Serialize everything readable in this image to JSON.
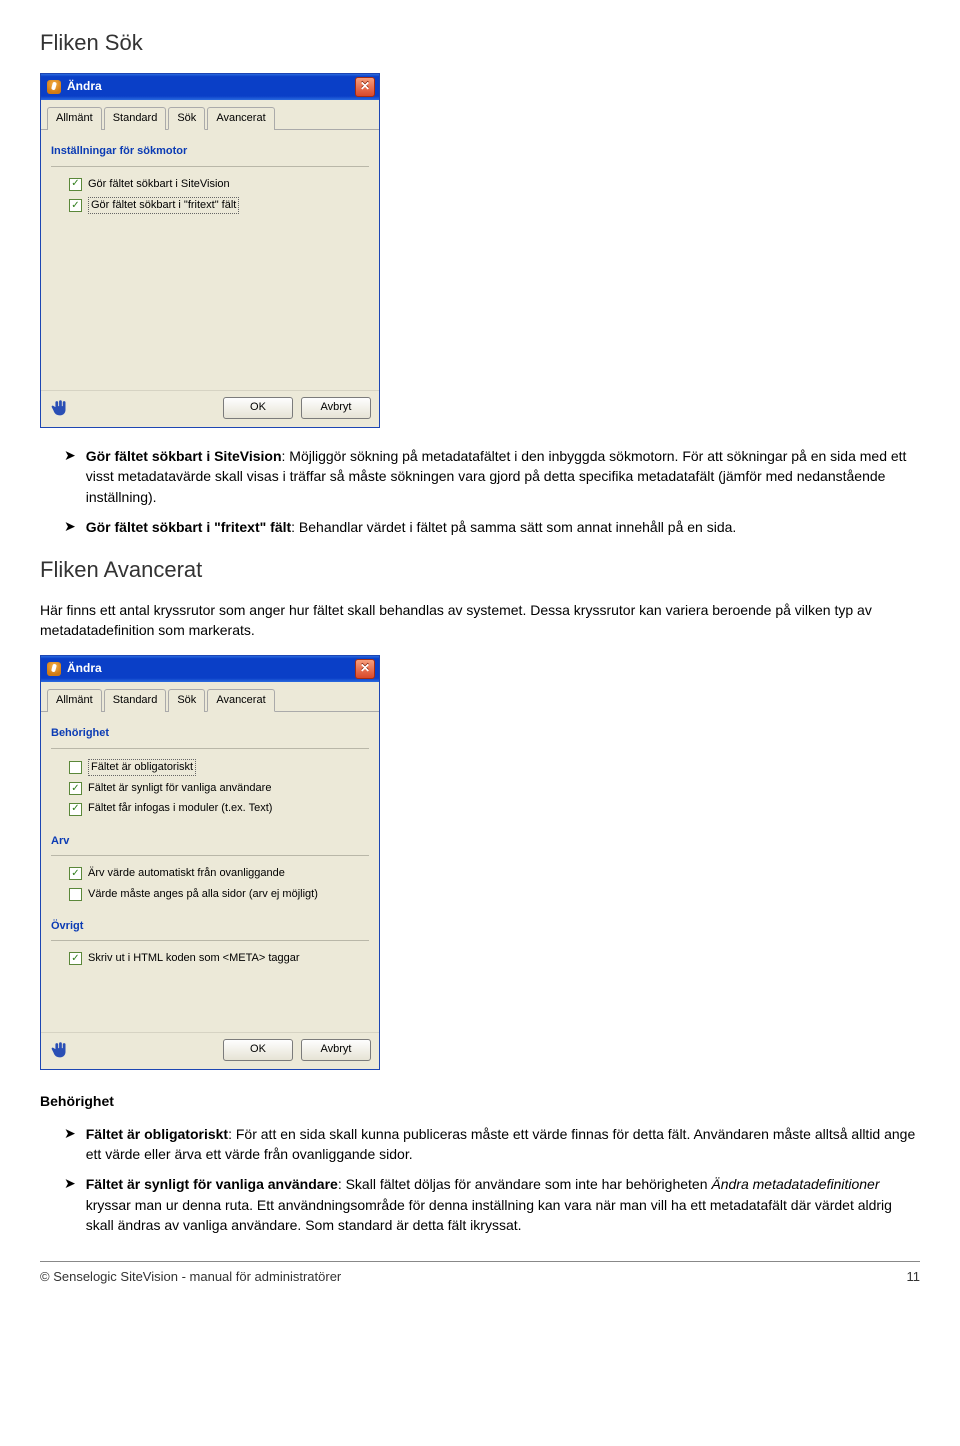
{
  "headings": {
    "sok": "Fliken Sök",
    "avancerat": "Fliken Avancerat"
  },
  "dialog1": {
    "title": "Ändra",
    "tabs": [
      "Allmänt",
      "Standard",
      "Sök",
      "Avancerat"
    ],
    "activeTab": "Sök",
    "group": "Inställningar för sökmotor",
    "checks": [
      {
        "label": "Gör fältet sökbart i SiteVision",
        "checked": true,
        "boxed": false
      },
      {
        "label": "Gör fältet sökbart i \"fritext\" fält",
        "checked": true,
        "boxed": true
      }
    ],
    "ok": "OK",
    "cancel": "Avbryt"
  },
  "bullets_after_d1": [
    {
      "strong": "Gör fältet sökbart i SiteVision",
      "rest": ": Möjliggör sökning på metadatafältet i den inbyggda sökmotorn. För att sökningar på en sida med ett visst metadatavärde skall visas i träffar så måste sökningen vara gjord på detta specifika metadatafält (jämför med nedanstående inställning)."
    },
    {
      "strong": "Gör fältet sökbart i \"fritext\" fält",
      "rest": ": Behandlar värdet i fältet på samma sätt som annat innehåll på en sida."
    }
  ],
  "para_avancerat": "Här finns ett antal kryssrutor som anger hur fältet skall behandlas av systemet. Dessa kryssrutor kan variera beroende på vilken typ av metadatadefinition som markerats.",
  "dialog2": {
    "title": "Ändra",
    "tabs": [
      "Allmänt",
      "Standard",
      "Sök",
      "Avancerat"
    ],
    "activeTab": "Avancerat",
    "groups": {
      "beh": "Behörighet",
      "arv": "Arv",
      "ovr": "Övrigt"
    },
    "checks": {
      "beh": [
        {
          "label": "Fältet är obligatoriskt",
          "checked": false,
          "boxed": true
        },
        {
          "label": "Fältet är synligt för vanliga användare",
          "checked": true,
          "boxed": false
        },
        {
          "label": "Fältet får infogas i moduler (t.ex. Text)",
          "checked": true,
          "boxed": false
        }
      ],
      "arv": [
        {
          "label": "Ärv värde automatiskt från ovanliggande",
          "checked": true,
          "boxed": false
        },
        {
          "label": "Värde måste anges på alla sidor (arv ej möjligt)",
          "checked": false,
          "boxed": false
        }
      ],
      "ovr": [
        {
          "label": "Skriv ut i HTML koden som <META> taggar",
          "checked": true,
          "boxed": false
        }
      ]
    },
    "ok": "OK",
    "cancel": "Avbryt"
  },
  "behorighet_heading": "Behörighet",
  "bullets_behorighet": [
    {
      "strong": "Fältet är obligatoriskt",
      "rest": ": För att en sida skall kunna publiceras måste ett värde finnas för detta fält. Användaren måste alltså alltid ange ett värde eller ärva ett värde från ovanliggande sidor."
    },
    {
      "strong": "Fältet är synligt för vanliga användare",
      "rest_pre": ": Skall fältet döljas för användare som inte har behörigheten ",
      "italic": "Ändra metadatadefinitioner",
      "rest_post": " kryssar man ur denna ruta. Ett användningsområde för denna inställning kan vara när man vill ha ett metadatafält där värdet aldrig skall ändras av vanliga användare. Som standard är detta fält ikryssat."
    }
  ],
  "footer": {
    "left": "© Senselogic SiteVision - manual för administratörer",
    "right": "11"
  }
}
